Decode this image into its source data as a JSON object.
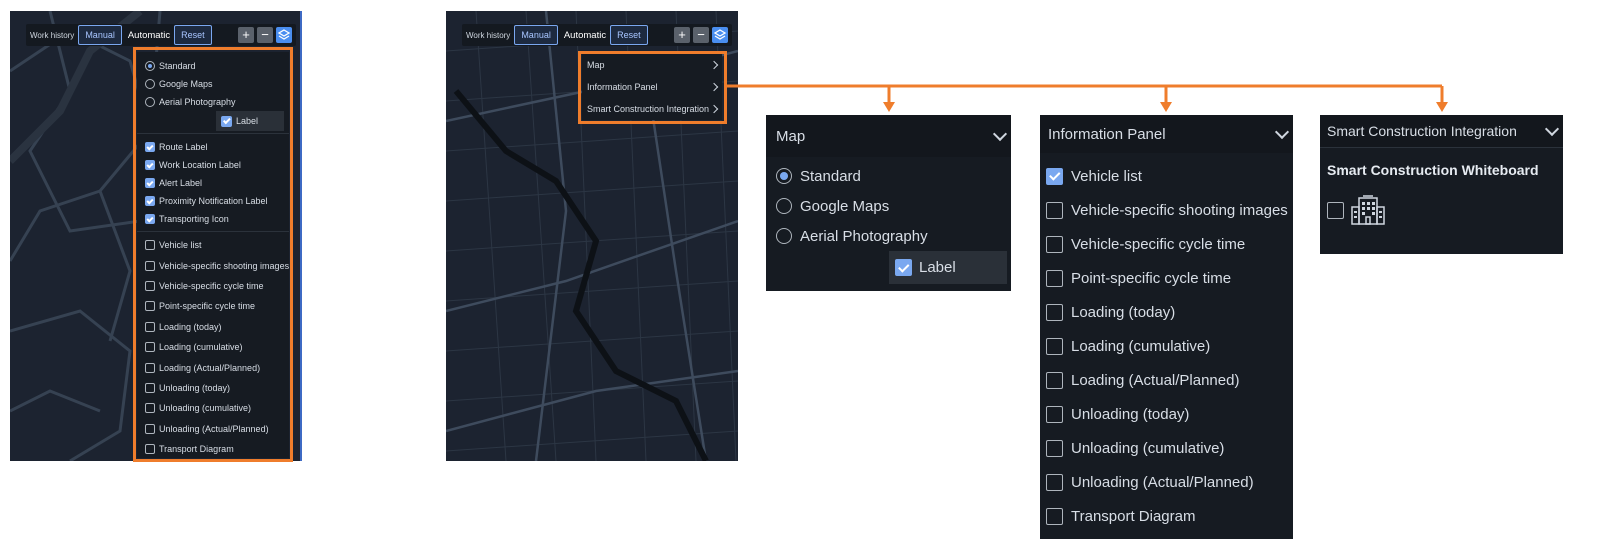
{
  "toolbar": {
    "work_history_label": "Work history",
    "manual_label": "Manual",
    "automatic_label": "Automatic",
    "reset_label": "Reset",
    "zoom_in_symbol": "+",
    "zoom_out_symbol": "−"
  },
  "left_menu": {
    "map_options": [
      {
        "label": "Standard",
        "selected": true
      },
      {
        "label": "Google Maps",
        "selected": false
      },
      {
        "label": "Aerial Photography",
        "selected": false
      }
    ],
    "label_toggle": {
      "label": "Label",
      "checked": true
    },
    "label_options": [
      {
        "label": "Route Label",
        "checked": true
      },
      {
        "label": "Work Location Label",
        "checked": true
      },
      {
        "label": "Alert Label",
        "checked": true
      },
      {
        "label": "Proximity Notification Label",
        "checked": true
      },
      {
        "label": "Transporting Icon",
        "checked": true
      }
    ],
    "panel_options": [
      {
        "label": "Vehicle list",
        "checked": false
      },
      {
        "label": "Vehicle-specific shooting images",
        "checked": false
      },
      {
        "label": "Vehicle-specific cycle time",
        "checked": false
      },
      {
        "label": "Point-specific cycle time",
        "checked": false
      },
      {
        "label": "Loading (today)",
        "checked": false
      },
      {
        "label": "Loading (cumulative)",
        "checked": false
      },
      {
        "label": "Loading (Actual/Planned)",
        "checked": false
      },
      {
        "label": "Unloading (today)",
        "checked": false
      },
      {
        "label": "Unloading (cumulative)",
        "checked": false
      },
      {
        "label": "Unloading (Actual/Planned)",
        "checked": false
      },
      {
        "label": "Transport Diagram",
        "checked": false
      }
    ]
  },
  "right_menu": {
    "items": [
      "Map",
      "Information Panel",
      "Smart Construction Integration"
    ]
  },
  "map_panel": {
    "title": "Map",
    "options": [
      {
        "label": "Standard",
        "selected": true
      },
      {
        "label": "Google Maps",
        "selected": false
      },
      {
        "label": "Aerial Photography",
        "selected": false
      }
    ],
    "label_toggle": {
      "label": "Label",
      "checked": true
    }
  },
  "info_panel": {
    "title": "Information Panel",
    "items": [
      {
        "label": "Vehicle list",
        "checked": true
      },
      {
        "label": "Vehicle-specific shooting images",
        "checked": false
      },
      {
        "label": "Vehicle-specific cycle time",
        "checked": false
      },
      {
        "label": "Point-specific cycle time",
        "checked": false
      },
      {
        "label": "Loading (today)",
        "checked": false
      },
      {
        "label": "Loading (cumulative)",
        "checked": false
      },
      {
        "label": "Loading (Actual/Planned)",
        "checked": false
      },
      {
        "label": "Unloading (today)",
        "checked": false
      },
      {
        "label": "Unloading (cumulative)",
        "checked": false
      },
      {
        "label": "Unloading (Actual/Planned)",
        "checked": false
      },
      {
        "label": "Transport Diagram",
        "checked": false
      }
    ]
  },
  "sc_panel": {
    "title": "Smart Construction Integration",
    "subtitle": "Smart Construction Whiteboard",
    "whiteboard_checked": false,
    "icon": "building-icon"
  },
  "colors": {
    "highlight": "#ef7d2c",
    "accent": "#7aa8f0",
    "menu_bg": "#161b22",
    "map_bg": "#1c2330"
  }
}
